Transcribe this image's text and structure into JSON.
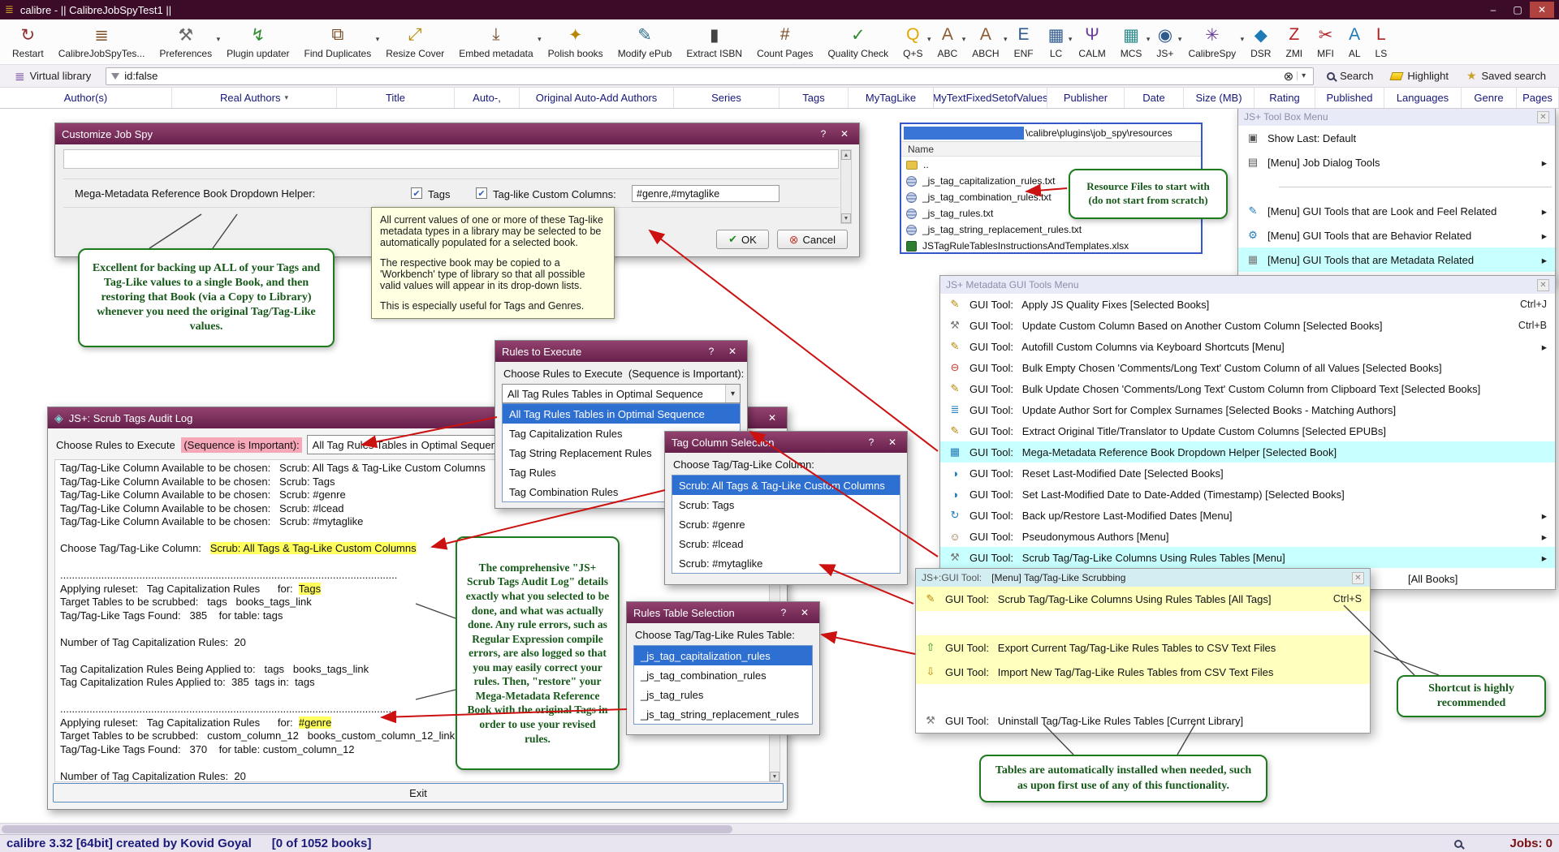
{
  "ui": {
    "help": "?",
    "close": "✕",
    "min": "–",
    "max": "▢",
    "up": "▲",
    "down": "▼",
    "check": "✔",
    "cancelx": "⊗",
    "combo_arrow": "▾",
    "menu_arrow": "▸"
  },
  "titlebar": {
    "title": "calibre - || CalibreJobSpyTest1 ||"
  },
  "toolbar": [
    {
      "label": "Restart",
      "g": "↻",
      "c": "#8c2f2f",
      "arr": ""
    },
    {
      "label": "CalibreJobSpyTes...",
      "g": "≣",
      "c": "#7a4a21",
      "arr": ""
    },
    {
      "label": "Preferences",
      "g": "⚒",
      "c": "#6b6b6b",
      "arr": "▾"
    },
    {
      "label": "Plugin updater",
      "g": "↯",
      "c": "#2e8b2e",
      "arr": ""
    },
    {
      "label": "Find Duplicates",
      "g": "⧉",
      "c": "#7a4a21",
      "arr": "▾"
    },
    {
      "label": "Resize Cover",
      "g": "⤢",
      "c": "#b58900",
      "arr": ""
    },
    {
      "label": "Embed metadata",
      "g": "⤓",
      "c": "#7a4a21",
      "arr": "▾"
    },
    {
      "label": "Polish books",
      "g": "✦",
      "c": "#b8860b",
      "arr": ""
    },
    {
      "label": "Modify ePub",
      "g": "✎",
      "c": "#2f6b8c",
      "arr": ""
    },
    {
      "label": "Extract ISBN",
      "g": "▮",
      "c": "#444444",
      "arr": ""
    },
    {
      "label": "Count Pages",
      "g": "#",
      "c": "#7a4a21",
      "arr": ""
    },
    {
      "label": "Quality Check",
      "g": "✓",
      "c": "#2e8b2e",
      "arr": ""
    },
    {
      "label": "Q+S",
      "g": "Q",
      "c": "#e0a800",
      "arr": "▾"
    },
    {
      "label": "ABC",
      "g": "A",
      "c": "#8c5a2f",
      "arr": "▾"
    },
    {
      "label": "ABCH",
      "g": "A",
      "c": "#8c5a2f",
      "arr": "▾"
    },
    {
      "label": "ENF",
      "g": "E",
      "c": "#2f5a8c",
      "arr": ""
    },
    {
      "label": "LC",
      "g": "▦",
      "c": "#2f5a8c",
      "arr": "▾"
    },
    {
      "label": "CALM",
      "g": "Ψ",
      "c": "#6a3d9a",
      "arr": ""
    },
    {
      "label": "MCS",
      "g": "▦",
      "c": "#2f8c8c",
      "arr": "▾"
    },
    {
      "label": "JS+",
      "g": "◉",
      "c": "#2f5a8c",
      "arr": "▾"
    },
    {
      "label": "CalibreSpy",
      "g": "✳",
      "c": "#6a3d9a",
      "arr": "▾"
    },
    {
      "label": "DSR",
      "g": "◆",
      "c": "#1f7ab8",
      "arr": ""
    },
    {
      "label": "ZMI",
      "g": "Z",
      "c": "#b22222",
      "arr": ""
    },
    {
      "label": "MFI",
      "g": "✂",
      "c": "#b22222",
      "arr": ""
    },
    {
      "label": "AL",
      "g": "A",
      "c": "#1f7ab8",
      "arr": ""
    },
    {
      "label": "LS",
      "g": "L",
      "c": "#b22222",
      "arr": ""
    }
  ],
  "searchrow": {
    "virtual_library": "Virtual library",
    "search_value": "id:false",
    "clear_glyph": "⊗",
    "search_label": "Search",
    "highlight_label": "Highlight",
    "saved_search_label": "Saved search"
  },
  "columns": [
    "Author(s)",
    "Real Authors",
    "Title",
    "Auto-,",
    "Original Auto-Add Authors",
    "Series",
    "Tags",
    "MyTagLike",
    "MyTextFixedSetofValues",
    "Publisher",
    "Date",
    "Size (MB)",
    "Rating",
    "Published",
    "Languages",
    "Genre",
    "Pages"
  ],
  "customize": {
    "title": "Customize Job Spy",
    "helper_label": "Mega-Metadata Reference Book Dropdown Helper:",
    "cb_tags": "Tags",
    "cb_taglike": "Tag-like Custom Columns:",
    "taglike_value": "#genre,#mytaglike",
    "ok": "OK",
    "cancel": "Cancel"
  },
  "tooltip": {
    "p1": "All current values of one or more of these Tag-like metadata types in a library may be selected to be automatically populated for a selected book.",
    "p2": "The respective book may be copied to a 'Workbench' type of library so that all possible valid values will appear in its drop-down lists.",
    "p3": "This is especially useful for Tags and Genres."
  },
  "notes": {
    "backup": "Excellent for backing up ALL of your Tags and Tag-Like values to a single Book, and then restoring that Book (via a Copy to Library) whenever you need the original Tag/Tag-Like values.",
    "resources": "Resource Files to start with (do not start from scratch)",
    "audit": "The comprehensive \"JS+ Scrub Tags Audit Log\" details exactly what you selected to be done, and what was actually done. Any rule errors, such as Regular Expression compile errors, are also logged so that you may easily correct your rules. Then, \"restore\" your Mega-Metadata Reference Book with the original Tags in order to use your revised rules.",
    "tables": "Tables are automatically installed when needed, such as upon first use of any of this functionality.",
    "shortcut": "Shortcut is highly recommended"
  },
  "resources": {
    "path": "\\calibre\\plugins\\job_spy\\resources",
    "name_header": "Name",
    "files": [
      {
        "name": "..",
        "cls": "t-folder"
      },
      {
        "name": "_js_tag_capitalization_rules.txt",
        "cls": "t-txt"
      },
      {
        "name": "_js_tag_combination_rules.txt",
        "cls": "t-txt"
      },
      {
        "name": "_js_tag_rules.txt",
        "cls": "t-txt"
      },
      {
        "name": "_js_tag_string_replacement_rules.txt",
        "cls": "t-txt"
      },
      {
        "name": "JSTagRuleTablesInstructionsAndTemplates.xlsx",
        "cls": "t-xlsx"
      }
    ]
  },
  "toolbox_menu": {
    "title": "JS+ Tool Box Menu",
    "items": [
      {
        "g": "▣",
        "c": "#555555",
        "label": "Show Last: Default",
        "right": ""
      },
      {
        "g": "▤",
        "c": "#555555",
        "label": "[Menu] Job Dialog Tools",
        "right": "▸"
      },
      {
        "cls": "sep"
      },
      {
        "g": "✎",
        "c": "#1f7ab8",
        "label": "[Menu] GUI Tools that are Look and Feel Related",
        "right": "▸"
      },
      {
        "g": "⚙",
        "c": "#1f7ab8",
        "label": "[Menu] GUI Tools that are Behavior Related",
        "right": "▸"
      },
      {
        "g": "▦",
        "c": "#777777",
        "label": "[Menu] GUI Tools that are Metadata Related",
        "right": "▸",
        "hl": "cyan"
      }
    ]
  },
  "metadata_menu": {
    "title": "JS+ Metadata GUI Tools Menu",
    "items": [
      {
        "g": "✎",
        "c": "#b8860b",
        "label": "GUI Tool:   Apply JS Quality Fixes [Selected Books]",
        "right": "Ctrl+J"
      },
      {
        "g": "⚒",
        "c": "#777777",
        "label": "GUI Tool:   Update Custom Column Based on Another Custom Column [Selected Books]",
        "right": "Ctrl+B"
      },
      {
        "g": "✎",
        "c": "#b8860b",
        "label": "GUI Tool:   Autofill Custom Columns via Keyboard Shortcuts [Menu]",
        "right": "▸"
      },
      {
        "g": "⊖",
        "c": "#c0392b",
        "label": "GUI Tool:   Bulk Empty Chosen 'Comments/Long Text' Custom Column of all Values [Selected Books]",
        "right": ""
      },
      {
        "g": "✎",
        "c": "#b8860b",
        "label": "GUI Tool:   Bulk Update Chosen 'Comments/Long Text' Custom Column from Clipboard Text [Selected Books]",
        "right": ""
      },
      {
        "g": "≣",
        "c": "#1f7ab8",
        "label": "GUI Tool:   Update Author Sort for Complex Surnames [Selected Books - Matching Authors]",
        "right": ""
      },
      {
        "g": "✎",
        "c": "#b8860b",
        "label": "GUI Tool:   Extract Original Title/Translator to Update Custom Columns [Selected EPUBs]",
        "right": ""
      },
      {
        "g": "▦",
        "c": "#1f7ab8",
        "label": "GUI Tool:   Mega-Metadata Reference Book Dropdown Helper [Selected Book]",
        "right": "",
        "hl": "cyan"
      },
      {
        "g": "◑",
        "c": "#1f7ab8",
        "label": "GUI Tool:   Reset Last-Modified Date [Selected Books]",
        "right": ""
      },
      {
        "g": "◑",
        "c": "#1f7ab8",
        "label": "GUI Tool:   Set Last-Modified Date to Date-Added (Timestamp) [Selected Books]",
        "right": ""
      },
      {
        "g": "↻",
        "c": "#1f7ab8",
        "label": "GUI Tool:   Back up/Restore Last-Modified Dates [Menu]",
        "right": "▸"
      },
      {
        "g": "☺",
        "c": "#8a6d3b",
        "label": "GUI Tool:   Pseudonymous Authors [Menu]",
        "right": "▸"
      },
      {
        "g": "⚒",
        "c": "#777777",
        "label": "GUI Tool:   Scrub Tag/Tag-Like Columns Using Rules Tables [Menu]",
        "right": "▸",
        "hl": "cyan"
      },
      {
        "g": "",
        "c": "",
        "label": "[All Books]",
        "right": "",
        "cls": "partial"
      }
    ]
  },
  "scrub_menu": {
    "title_prefix": "JS+:GUI Tool:",
    "title": "[Menu] Tag/Tag-Like Scrubbing",
    "items": [
      {
        "g": "✎",
        "c": "#b8860b",
        "label": "GUI Tool:   Scrub Tag/Tag-Like Columns Using Rules Tables [All Tags]",
        "right": "Ctrl+S",
        "hl": "yellow"
      },
      {
        "cls": "gap-lg"
      },
      {
        "g": "⇧",
        "c": "#2e8b2e",
        "label": "GUI Tool:   Export Current Tag/Tag-Like Rules Tables to CSV Text Files",
        "right": "",
        "hl": "yellow"
      },
      {
        "g": "⇩",
        "c": "#b8860b",
        "label": "GUI Tool:   Import New Tag/Tag-Like Rules Tables from CSV Text Files",
        "right": "",
        "hl": "yellow"
      },
      {
        "cls": "gap-sm"
      },
      {
        "g": "⚒",
        "c": "#777777",
        "label": "GUI Tool:   Uninstall Tag/Tag-Like Rules Tables [Current Library]",
        "right": ""
      }
    ]
  },
  "rules_exec": {
    "title": "Rules to Execute",
    "label": "Choose Rules to Execute  (Sequence is Important):",
    "combo_value": "All Tag Rules Tables in Optimal Sequence",
    "options": [
      {
        "label": "All Tag Rules Tables in Optimal Sequence",
        "cls": "sel"
      },
      {
        "label": "Tag Capitalization Rules"
      },
      {
        "label": "Tag String Replacement Rules"
      },
      {
        "label": "Tag Rules"
      },
      {
        "label": "Tag Combination Rules"
      }
    ]
  },
  "tag_column": {
    "title": "Tag Column Selection",
    "label": "Choose Tag/Tag-Like Column:",
    "options": [
      {
        "label": "Scrub: All Tags & Tag-Like Custom Columns",
        "cls": "sel"
      },
      {
        "label": "Scrub: Tags"
      },
      {
        "label": "Scrub: #genre"
      },
      {
        "label": "Scrub: #lcead"
      },
      {
        "label": "Scrub: #mytaglike"
      }
    ]
  },
  "rules_table": {
    "title": "Rules Table Selection",
    "label": "Choose Tag/Tag-Like Rules Table:",
    "options": [
      {
        "label": "_js_tag_capitalization_rules",
        "cls": "sel"
      },
      {
        "label": "_js_tag_combination_rules"
      },
      {
        "label": "_js_tag_rules"
      },
      {
        "label": "_js_tag_string_replacement_rules"
      }
    ]
  },
  "audit": {
    "title": "JS+:  Scrub Tags Audit Log",
    "header_label": "Choose Rules to Execute ",
    "header_hl": "(Sequence is Important):",
    "header_combo": "All Tag Rules Tables in Optimal Sequence",
    "exit": "Exit",
    "lines": [
      {
        "t": "Tag/Tag-Like Column Available to be chosen:   Scrub: All Tags & Tag-Like Custom Columns"
      },
      {
        "t": "Tag/Tag-Like Column Available to be chosen:   Scrub: Tags"
      },
      {
        "t": "Tag/Tag-Like Column Available to be chosen:   Scrub: #genre"
      },
      {
        "t": "Tag/Tag-Like Column Available to be chosen:   Scrub: #lcead"
      },
      {
        "t": "Tag/Tag-Like Column Available to be chosen:   Scrub: #mytaglike"
      },
      {
        "t": ""
      },
      {
        "t": "Choose Tag/Tag-Like Column:   ",
        "h": "Scrub: All Tags & Tag-Like Custom Columns"
      },
      {
        "t": ""
      },
      {
        "t": "..................................................................................................................."
      },
      {
        "t": "Applying ruleset:   Tag Capitalization Rules      for:  ",
        "h": "Tags"
      },
      {
        "t": "Target Tables to be scrubbed:   tags   books_tags_link"
      },
      {
        "t": "Tag/Tag-Like Tags Found:   385    for table: tags"
      },
      {
        "t": ""
      },
      {
        "t": "Number of Tag Capitalization Rules:  20"
      },
      {
        "t": ""
      },
      {
        "t": "Tag Capitalization Rules Being Applied to:   tags   books_tags_link"
      },
      {
        "t": "Tag Capitalization Rules Applied to:  385  tags in:  tags"
      },
      {
        "t": ""
      },
      {
        "t": "..................................................................................................................."
      },
      {
        "t": "Applying ruleset:   Tag Capitalization Rules      for:  ",
        "h": "#genre"
      },
      {
        "t": "Target Tables to be scrubbed:   custom_column_12   books_custom_column_12_link"
      },
      {
        "t": "Tag/Tag-Like Tags Found:   370    for table: custom_column_12"
      },
      {
        "t": ""
      },
      {
        "t": "Number of Tag Capitalization Rules:  20"
      }
    ]
  },
  "statusbar": {
    "left": "calibre 3.32 [64bit] created by Kovid Goyal      [0 of 1052 books]",
    "jobs": "Jobs: 0",
    "icons": [
      {
        "g": "◫",
        "c": "#1f7ab8"
      },
      {
        "g": "▦",
        "c": "#1f7ab8"
      },
      {
        "g": "▦",
        "c": "#1f7ab8"
      },
      {
        "g": "◉",
        "c": "#8c1d1d"
      },
      {
        "g": "▤",
        "c": "#b8860b"
      }
    ]
  }
}
